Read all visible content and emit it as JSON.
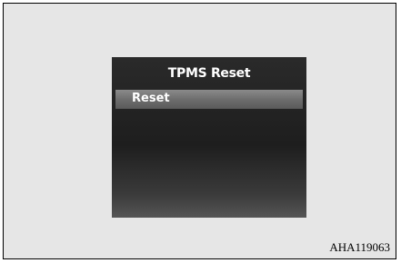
{
  "screen": {
    "title": "TPMS Reset",
    "menu_items": [
      {
        "label": "Reset",
        "selected": true
      }
    ]
  },
  "figure_id": "AHA119063",
  "colors": {
    "frame_background": "#e6e6e6",
    "screen_background": "#1e1e1e",
    "selection_highlight": "#6e6e6e",
    "text": "#ffffff"
  }
}
